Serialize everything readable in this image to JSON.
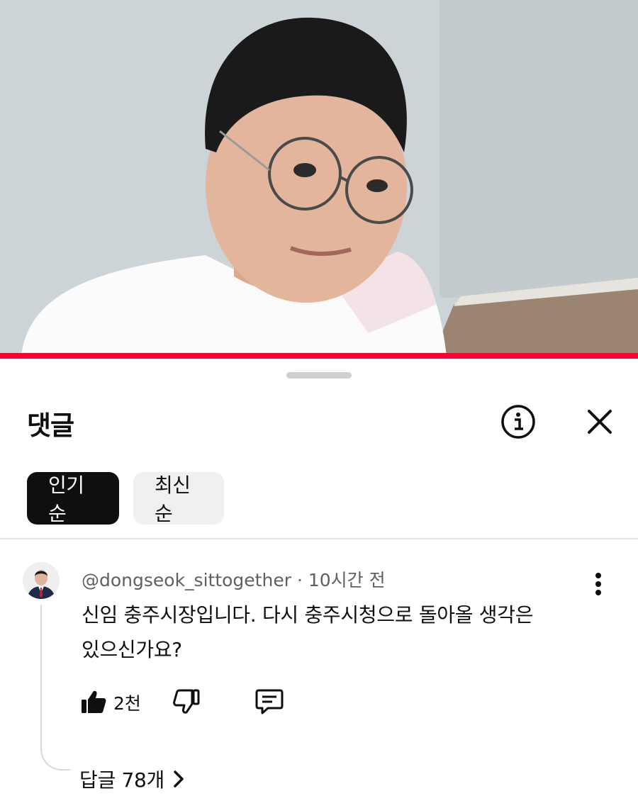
{
  "video": {
    "image": "person-wearing-glasses-and-white-shirt",
    "progress_color": "#ff0033"
  },
  "sheet": {
    "title": "댓글",
    "info_icon": "info-icon",
    "close_icon": "close-icon"
  },
  "sort": {
    "options": [
      {
        "label": "인기순",
        "selected": true
      },
      {
        "label": "최신순",
        "selected": false
      }
    ]
  },
  "comment": {
    "author": "@dongseok_sittogether",
    "separator": "·",
    "time": "10시간 전",
    "text": "신임 충주시장입니다. 다시 충주시청으로 돌아올 생각은 있으신가요?",
    "like_count": "2천",
    "replies_label": "답글 78개"
  }
}
